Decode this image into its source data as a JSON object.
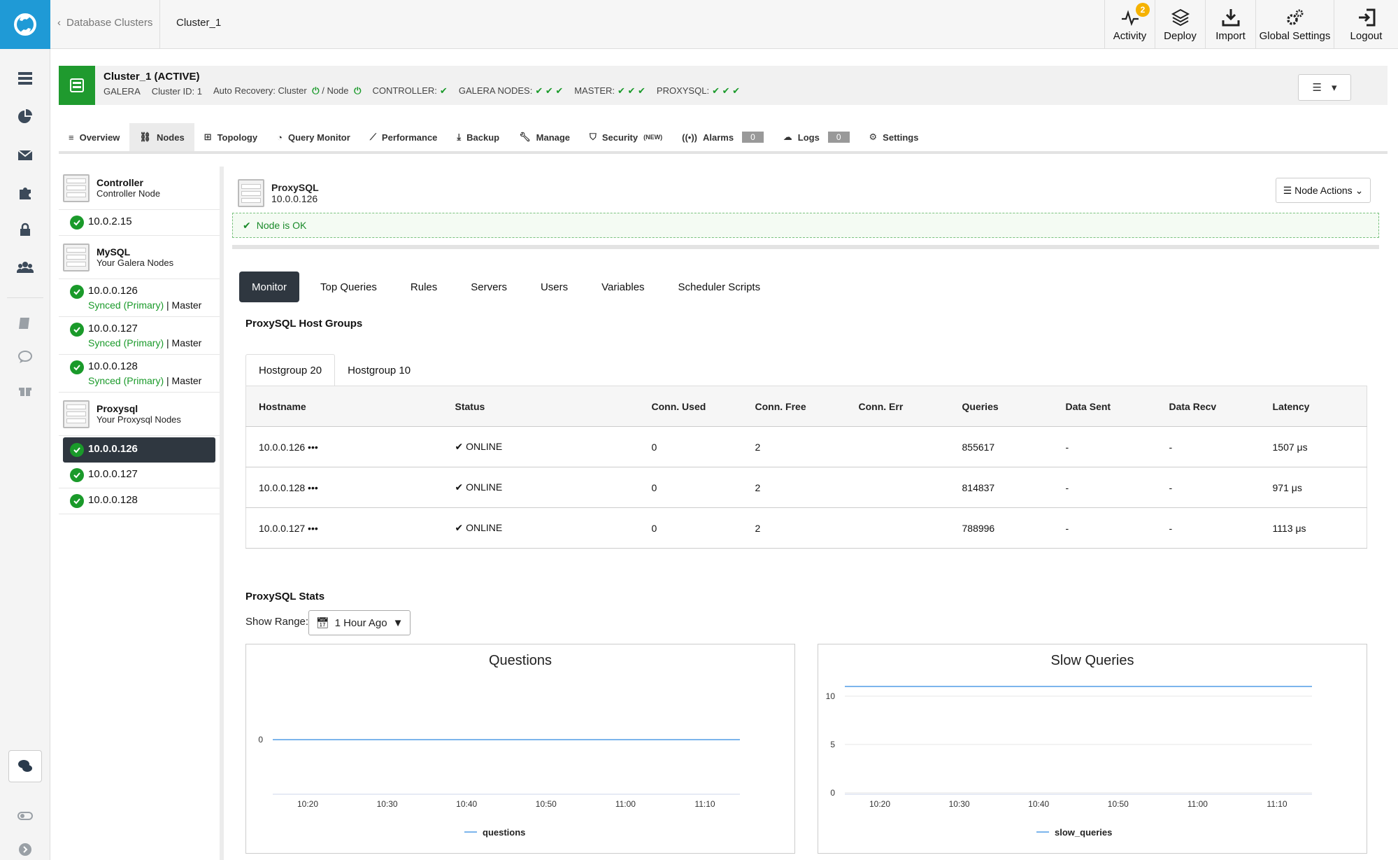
{
  "breadcrumb": {
    "back_label": "Database Clusters",
    "current": "Cluster_1"
  },
  "topnav": [
    {
      "label": "Activity",
      "icon": "activity-icon",
      "badge": "2"
    },
    {
      "label": "Deploy",
      "icon": "deploy-icon"
    },
    {
      "label": "Import",
      "icon": "import-icon"
    },
    {
      "label": "Global Settings",
      "icon": "gears-icon"
    },
    {
      "label": "Logout",
      "icon": "logout-icon"
    }
  ],
  "cluster": {
    "name": "Cluster_1 (ACTIVE)",
    "type": "GALERA",
    "cluster_id": "Cluster ID: 1",
    "auto_recovery": "Auto Recovery: Cluster",
    "auto_recovery_node": "/ Node",
    "controller": "CONTROLLER:",
    "galera_nodes": "GALERA NODES:",
    "master": "MASTER:",
    "proxysql": "PROXYSQL:"
  },
  "tabs": [
    {
      "label": "Overview"
    },
    {
      "label": "Nodes"
    },
    {
      "label": "Topology"
    },
    {
      "label": "Query Monitor"
    },
    {
      "label": "Performance"
    },
    {
      "label": "Backup"
    },
    {
      "label": "Manage"
    },
    {
      "label": "Security",
      "sup": "(NEW)"
    },
    {
      "label": "Alarms",
      "count": "0"
    },
    {
      "label": "Logs",
      "count": "0"
    },
    {
      "label": "Settings"
    }
  ],
  "node_list": {
    "controller": {
      "title": "Controller",
      "subtitle": "Controller Node",
      "ip": "10.0.2.15"
    },
    "mysql": {
      "title": "MySQL",
      "subtitle": "Your Galera Nodes",
      "nodes": [
        {
          "ip": "10.0.0.126",
          "status": "Synced (Primary)",
          "role": "| Master"
        },
        {
          "ip": "10.0.0.127",
          "status": "Synced (Primary)",
          "role": "| Master"
        },
        {
          "ip": "10.0.0.128",
          "status": "Synced (Primary)",
          "role": "| Master"
        }
      ]
    },
    "proxysql": {
      "title": "Proxysql",
      "subtitle": "Your Proxysql Nodes",
      "nodes": [
        {
          "ip": "10.0.0.126"
        },
        {
          "ip": "10.0.0.127"
        },
        {
          "ip": "10.0.0.128"
        }
      ]
    }
  },
  "node_detail": {
    "title": "ProxySQL",
    "ip": "10.0.0.126",
    "actions_label": "Node Actions",
    "status_message": "Node is OK"
  },
  "subtabs": [
    "Monitor",
    "Top Queries",
    "Rules",
    "Servers",
    "Users",
    "Variables",
    "Scheduler Scripts"
  ],
  "host_groups": {
    "title": "ProxySQL Host Groups",
    "tabs": [
      "Hostgroup 20",
      "Hostgroup 10"
    ],
    "columns": [
      "Hostname",
      "Status",
      "Conn. Used",
      "Conn. Free",
      "Conn. Err",
      "Queries",
      "Data Sent",
      "Data Recv",
      "Latency"
    ],
    "rows": [
      [
        "10.0.0.126 •••",
        "ONLINE",
        "0",
        "2",
        "",
        "855617",
        "-",
        "-",
        "1507 μs"
      ],
      [
        "10.0.0.128 •••",
        "ONLINE",
        "0",
        "2",
        "",
        "814837",
        "-",
        "-",
        "971 μs"
      ],
      [
        "10.0.0.127 •••",
        "ONLINE",
        "0",
        "2",
        "",
        "788996",
        "-",
        "-",
        "1113 μs"
      ]
    ]
  },
  "stats": {
    "title": "ProxySQL Stats",
    "range_label": "Show Range:",
    "range_value": "1 Hour Ago"
  },
  "chart_data": [
    {
      "type": "line",
      "title": "Questions",
      "x": [
        "10:20",
        "10:30",
        "10:40",
        "10:50",
        "11:00",
        "11:10"
      ],
      "series": [
        {
          "name": "questions",
          "values": [
            0,
            0,
            0,
            0,
            0,
            0
          ]
        }
      ],
      "yticks": [
        0
      ],
      "color": "#7cb5ec"
    },
    {
      "type": "line",
      "title": "Slow Queries",
      "x": [
        "10:20",
        "10:30",
        "10:40",
        "10:50",
        "11:00",
        "11:10"
      ],
      "series": [
        {
          "name": "slow_queries",
          "values": [
            11,
            11,
            11,
            11,
            11,
            11
          ]
        }
      ],
      "yticks": [
        0,
        5,
        10
      ],
      "ylim": [
        0,
        11
      ],
      "color": "#7cb5ec"
    }
  ]
}
